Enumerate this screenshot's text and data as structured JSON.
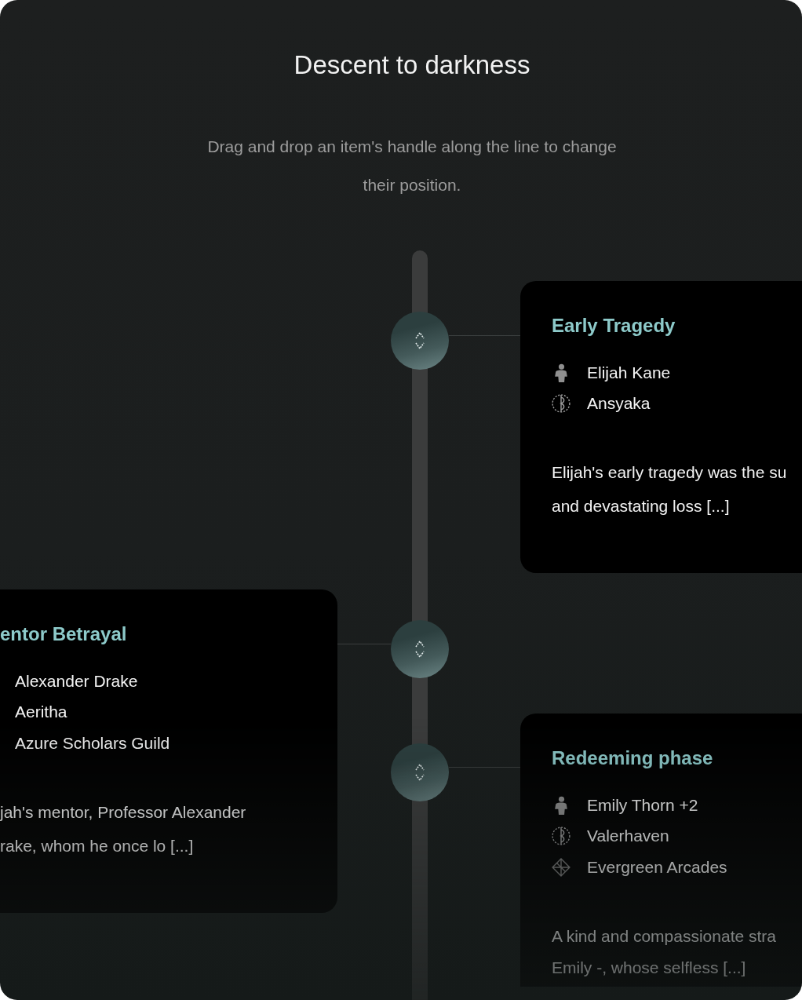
{
  "header": {
    "title": "Descent to darkness",
    "subtitle": "Drag and drop an item's handle along the line to change their position."
  },
  "timeline": {
    "events": [
      {
        "title": "Early Tragedy",
        "entities": [
          {
            "kind": "character",
            "label": "Elijah Kane"
          },
          {
            "kind": "world",
            "label": "Ansyaka"
          }
        ],
        "description_lines": [
          "Elijah's early tragedy was the su",
          "and devastating loss [...]"
        ]
      },
      {
        "title": "entor Betrayal",
        "entities": [
          {
            "label": "Alexander Drake"
          },
          {
            "label": "Aeritha"
          },
          {
            "label": "Azure Scholars Guild"
          }
        ],
        "description_lines": [
          "jah's mentor, Professor Alexander",
          "rake, whom he once lo [...]"
        ]
      },
      {
        "title": "Redeeming phase",
        "entities": [
          {
            "kind": "character",
            "label": "Emily Thorn +2"
          },
          {
            "kind": "world",
            "label": "Valerhaven"
          },
          {
            "kind": "location",
            "label": "Evergreen Arcades"
          }
        ],
        "description_lines": [
          "A kind and compassionate stra",
          "Emily -, whose selfless [...]"
        ]
      }
    ]
  }
}
